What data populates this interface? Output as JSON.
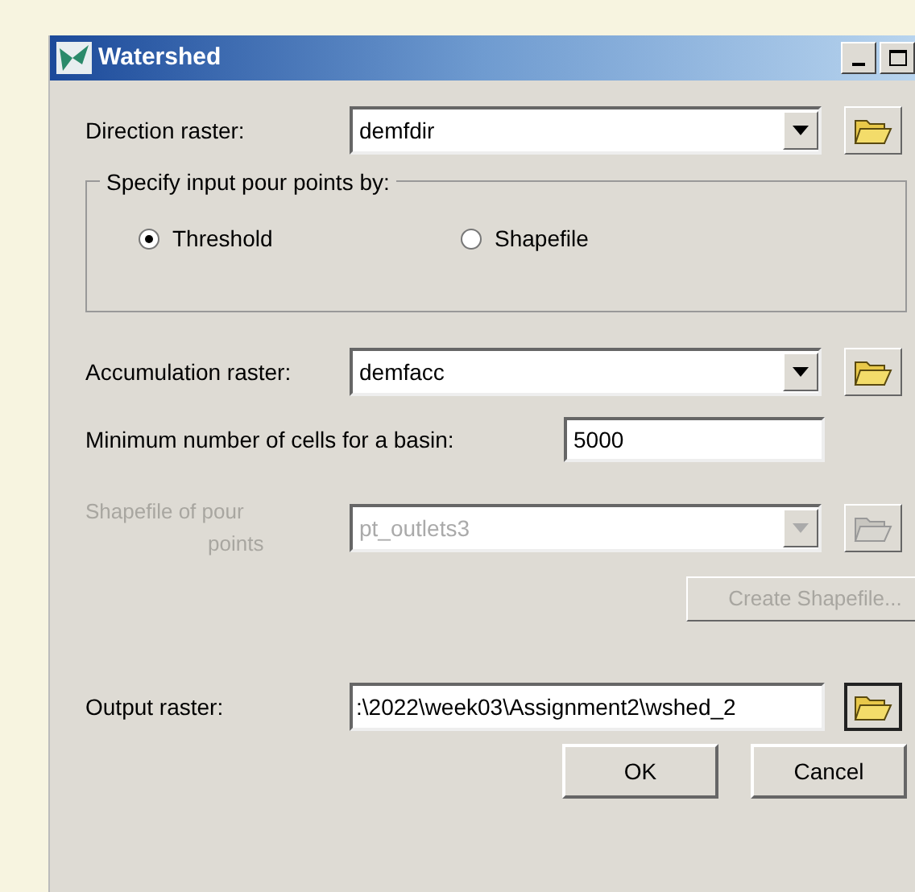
{
  "window": {
    "title": "Watershed"
  },
  "direction_raster": {
    "label": "Direction raster:",
    "value": "demfdir",
    "disabled": false
  },
  "pour_points_group": {
    "title": "Specify input pour points by:",
    "options": [
      {
        "label": "Threshold",
        "selected": true
      },
      {
        "label": "Shapefile",
        "selected": false
      }
    ]
  },
  "accumulation_raster": {
    "label": "Accumulation raster:",
    "value": "demfacc",
    "disabled": false
  },
  "min_cells": {
    "label": "Minimum number of cells for a basin:",
    "value": "5000"
  },
  "shapefile": {
    "label_line1": "Shapefile of pour",
    "label_line2": "points",
    "value": "pt_outlets3",
    "disabled": true
  },
  "create_shapefile_button": {
    "label": "Create Shapefile...",
    "disabled": true
  },
  "output_raster": {
    "label": "Output raster:",
    "value": ":\\2022\\week03\\Assignment2\\wshed_2"
  },
  "buttons": [
    "OK",
    "Cancel"
  ]
}
